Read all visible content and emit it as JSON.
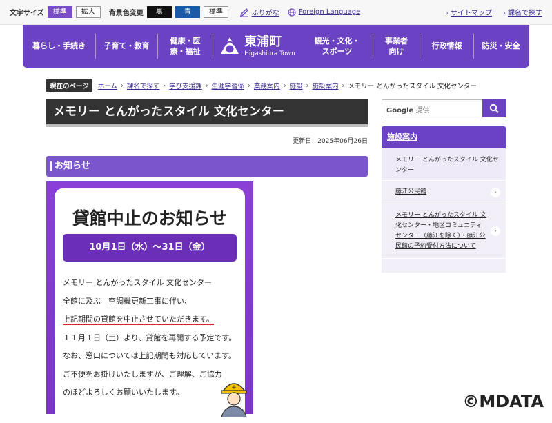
{
  "util": {
    "font_size_label": "文字サイズ",
    "font_standard": "標準",
    "font_large": "拡大",
    "bg_color_label": "背景色変更",
    "bg_black": "黒",
    "bg_blue": "青",
    "bg_standard": "標準",
    "furigana": "ふりがな",
    "foreign_language": "Foreign Language",
    "sitemap": "サイトマップ",
    "dept_search": "課名で探す"
  },
  "nav": {
    "items": [
      "暮らし・手続き",
      "子育て・教育",
      "健康・医療・福祉",
      "観光・文化・スポーツ",
      "事業者向け",
      "行政情報",
      "防災・安全"
    ],
    "logo_name": "東浦町",
    "logo_sub": "Higashiura Town"
  },
  "breadcrumb": {
    "current_label": "現在のページ",
    "links": [
      "ホーム",
      "課名で探す",
      "学び支援課",
      "生涯学習係",
      "業務案内",
      "施設",
      "施設案内"
    ],
    "current": "メモリー とんがったスタイル 文化センター"
  },
  "page": {
    "title": "メモリー とんがったスタイル 文化センター",
    "updated": "更新日：2025年06月26日",
    "section_heading": "お知らせ"
  },
  "poster": {
    "heading": "貸館中止のお知らせ",
    "date": "10月1日（水）～31日（金）",
    "lines": [
      "メモリー とんがったスタイル 文化センター",
      "全館に及ぶ　空調機更新工事に伴い、",
      "上記期間の貸館を中止させていただきます。",
      "１１月１日（土）より、貸館を再開する予定です。",
      "なお、窓口については上記期間も対応しています。",
      "ご不便をお掛けいたしますが、ご理解、ご協力",
      "のほどよろしくお願いいたします。"
    ]
  },
  "search": {
    "google": "Google",
    "placeholder": "提供"
  },
  "sidebar": {
    "heading": "施設案内",
    "current": "メモリー とんがったスタイル 文化センター",
    "items": [
      "藤江公民館",
      "メモリー とんがったスタイル 文化センター・地区コミュニティセンター（藤江を除く）・藤江公民館の予約受付方法について"
    ]
  },
  "watermark": "©MDATA",
  "colors": {
    "brand": "#6b43c2",
    "accent": "#7a55cc",
    "dark": "#333333"
  }
}
